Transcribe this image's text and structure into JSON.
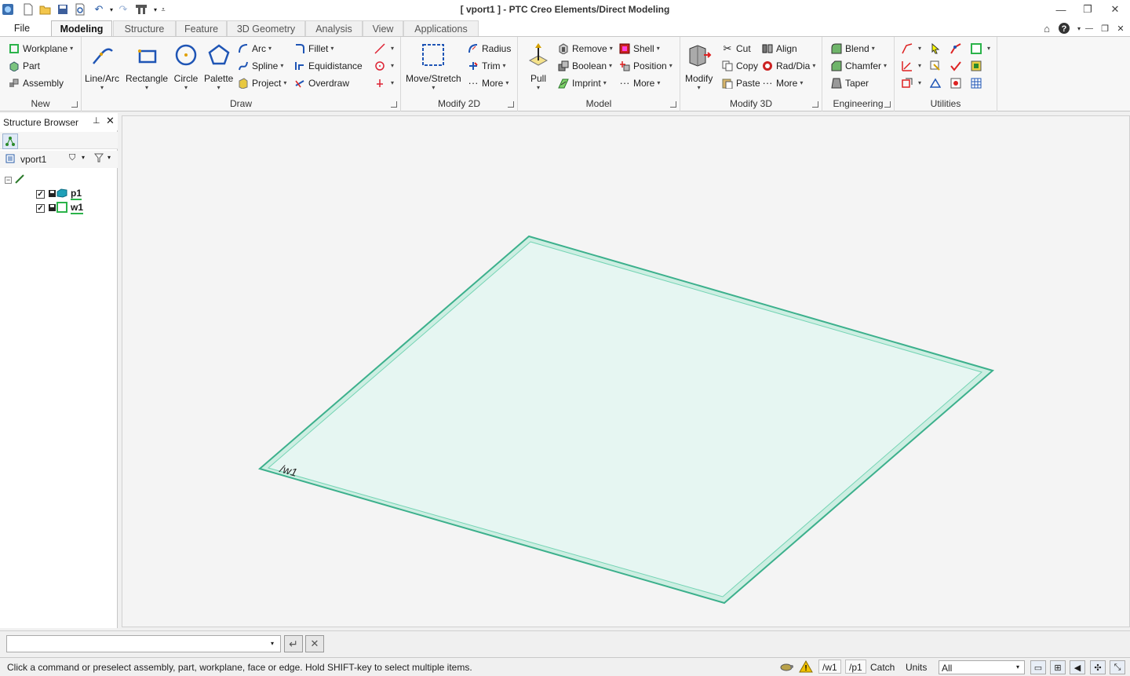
{
  "window": {
    "title": "[ vport1 ] - PTC Creo Elements/Direct Modeling"
  },
  "tabs": [
    "File",
    "Modeling",
    "Structure",
    "Feature",
    "3D Geometry",
    "Analysis",
    "View",
    "Applications"
  ],
  "ribbon": {
    "new": {
      "label": "New",
      "items": [
        "Workplane",
        "Part",
        "Assembly"
      ]
    },
    "draw": {
      "label": "Draw",
      "big": [
        "Line/Arc",
        "Rectangle",
        "Circle",
        "Palette"
      ],
      "col1": [
        "Arc",
        "Spline",
        "Project"
      ],
      "col2": [
        "Fillet",
        "Equidistance",
        "Overdraw"
      ]
    },
    "modify2d": {
      "label": "Modify 2D",
      "big": "Move/Stretch",
      "items": [
        "Radius",
        "Trim",
        "More"
      ]
    },
    "model": {
      "label": "Model",
      "big": "Pull",
      "col1": [
        "Remove",
        "Boolean",
        "Imprint"
      ],
      "col2": [
        "Shell",
        "Position",
        "More"
      ]
    },
    "modify3d": {
      "label": "Modify 3D",
      "big": "Modify",
      "col1": [
        "Cut",
        "Copy",
        "Paste"
      ],
      "col2": [
        "Align",
        "Rad/Dia",
        "More"
      ]
    },
    "engineering": {
      "label": "Engineering",
      "items": [
        "Blend",
        "Chamfer",
        "Taper"
      ]
    },
    "utilities": {
      "label": "Utilities"
    }
  },
  "structure_browser": {
    "title": "Structure Browser",
    "root": "vport1",
    "items": [
      {
        "name": "p1",
        "checked": true
      },
      {
        "name": "w1",
        "checked": true
      }
    ]
  },
  "viewport": {
    "workplane_label": "/w1",
    "plane_fill": "#e6f6f2",
    "plane_edge": "#3cb08c"
  },
  "command_line": {
    "value": ""
  },
  "status": {
    "message": "Click a command or preselect assembly, part, workplane, face or edge. Hold SHIFT-key to select multiple items.",
    "workplane": "/w1",
    "part": "/p1",
    "catch": "Catch",
    "units": "Units",
    "filter": "All"
  }
}
